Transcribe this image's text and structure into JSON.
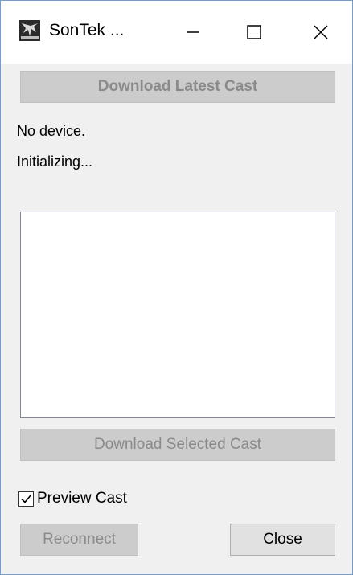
{
  "window": {
    "title": "SonTek ...",
    "icon": "sontek-app-icon",
    "controls": [
      "minimize-icon",
      "maximize-icon",
      "close-icon"
    ]
  },
  "buttons": {
    "download_latest": "Download Latest Cast",
    "download_selected": "Download Selected Cast",
    "reconnect": "Reconnect",
    "close": "Close"
  },
  "status": {
    "device": "No device.",
    "state": "Initializing..."
  },
  "cast_list": [],
  "preview": {
    "label": "Preview Cast",
    "checked": true
  },
  "colors": {
    "disabled_button": "#cccccc",
    "disabled_text": "#8a8a8a",
    "window_border": "#7a9cc4",
    "background": "#f0f0f0"
  }
}
